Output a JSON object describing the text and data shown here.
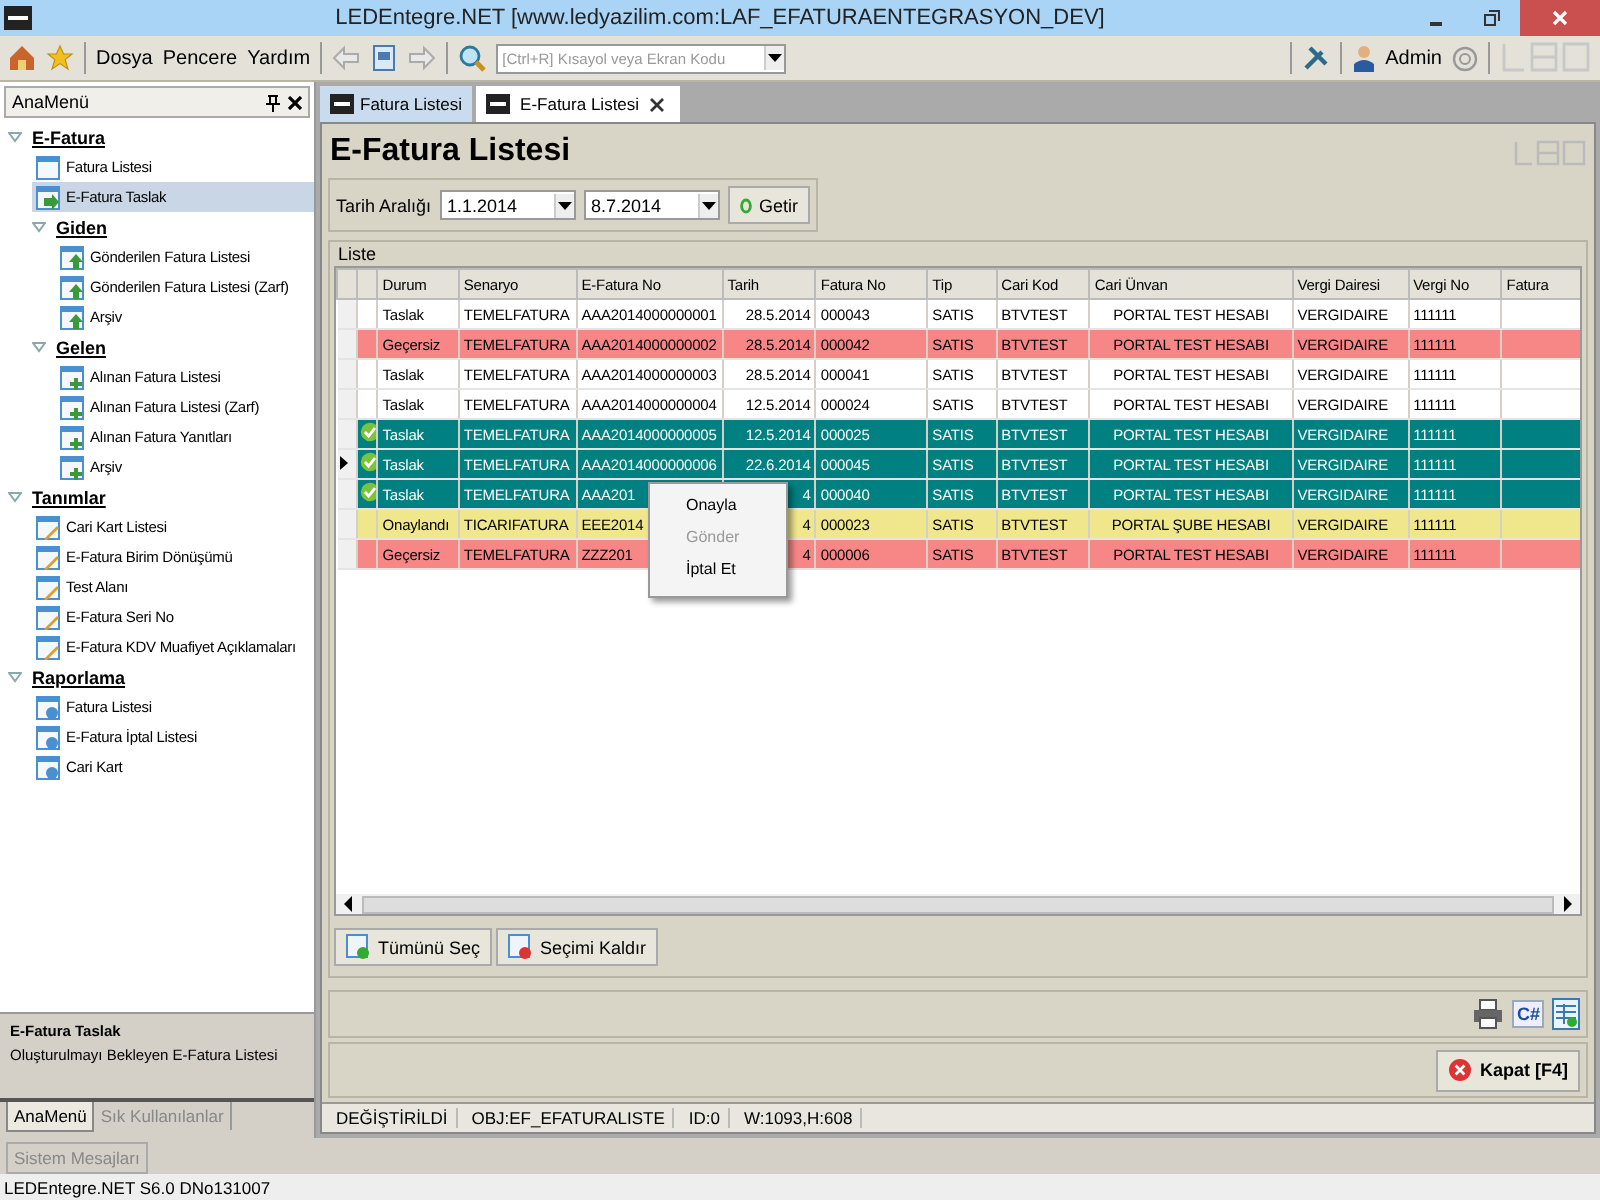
{
  "window": {
    "title": "LEDEntegre.NET [www.ledyazilim.com:LAF_EFATURAENTEGRASYON_DEV]"
  },
  "toolbar": {
    "menus": [
      "Dosya",
      "Pencere",
      "Yardım"
    ],
    "search": {
      "placeholder": "[Ctrl+R] Kısayol veya Ekran Kodu"
    },
    "user": "Admin"
  },
  "sidebar": {
    "title": "AnaMenü",
    "tree": [
      {
        "label": "E-Fatura",
        "kind": "group",
        "expanded": true,
        "selected": false,
        "children": [
          {
            "label": "Fatura Listesi",
            "kind": "list",
            "selected": false
          },
          {
            "label": "E-Fatura Taslak",
            "kind": "arrow",
            "selected": true
          },
          {
            "label": "Giden",
            "kind": "group",
            "expanded": true,
            "selected": false,
            "children": [
              {
                "label": "Gönderilen Fatura Listesi",
                "kind": "up",
                "selected": false
              },
              {
                "label": "Gönderilen Fatura Listesi (Zarf)",
                "kind": "up",
                "selected": false
              },
              {
                "label": "Arşiv",
                "kind": "up",
                "selected": false
              }
            ]
          },
          {
            "label": "Gelen",
            "kind": "group",
            "expanded": true,
            "selected": false,
            "children": [
              {
                "label": "Alınan Fatura Listesi",
                "kind": "plus",
                "selected": false
              },
              {
                "label": "Alınan Fatura Listesi (Zarf)",
                "kind": "plus",
                "selected": false
              },
              {
                "label": "Alınan Fatura Yanıtları",
                "kind": "plus",
                "selected": false
              },
              {
                "label": "Arşiv",
                "kind": "plus",
                "selected": false
              }
            ]
          }
        ]
      },
      {
        "label": "Tanımlar",
        "kind": "group",
        "expanded": true,
        "selected": false,
        "children": [
          {
            "label": "Cari Kart Listesi",
            "kind": "edit",
            "selected": false
          },
          {
            "label": "E-Fatura Birim Dönüşümü",
            "kind": "edit",
            "selected": false
          },
          {
            "label": "Test Alanı",
            "kind": "edit",
            "selected": false
          },
          {
            "label": "E-Fatura Seri No",
            "kind": "edit",
            "selected": false
          },
          {
            "label": "E-Fatura KDV Muafiyet Açıklamaları",
            "kind": "edit",
            "selected": false
          }
        ]
      },
      {
        "label": "Raporlama",
        "kind": "group",
        "expanded": true,
        "selected": false,
        "children": [
          {
            "label": "Fatura Listesi",
            "kind": "report",
            "selected": false
          },
          {
            "label": "E-Fatura İptal Listesi",
            "kind": "report",
            "selected": false
          },
          {
            "label": "Cari Kart",
            "kind": "report",
            "selected": false
          }
        ]
      }
    ],
    "description": {
      "title": "E-Fatura Taslak",
      "text": "Oluşturulmayı Bekleyen E-Fatura Listesi"
    },
    "tabs": [
      {
        "label": "AnaMenü",
        "selected": true
      },
      {
        "label": "Sık Kullanılanlar",
        "selected": false
      }
    ]
  },
  "doc_tabs": [
    {
      "label": "Fatura Listesi",
      "selected": false
    },
    {
      "label": "E-Fatura Listesi",
      "selected": true
    }
  ],
  "page": {
    "title": "E-Fatura Listesi",
    "filter": {
      "label": "Tarih Aralığı",
      "from": "1.1.2014",
      "to": "8.7.2014",
      "button": "Getir"
    }
  },
  "table": {
    "title": "Liste",
    "columns": [
      "Durum",
      "Senaryo",
      "E-Fatura No",
      "Tarih",
      "Fatura No",
      "Tip",
      "Cari Kod",
      "Cari Ünvan",
      "Vergi Dairesi",
      "Vergi No",
      "Fatura"
    ],
    "rows": [
      {
        "cells": [
          "Taslak",
          "TEMELFATURA",
          "AAA2014000000001",
          "28.5.2014",
          "000043",
          "SATIS",
          "BTVTEST",
          "PORTAL TEST HESABI",
          "VERGIDAIRE",
          "111111",
          ""
        ],
        "color": "#ffffff",
        "checked": false,
        "selected": false
      },
      {
        "cells": [
          "Geçersiz",
          "TEMELFATURA",
          "AAA2014000000002",
          "28.5.2014",
          "000042",
          "SATIS",
          "BTVTEST",
          "PORTAL TEST HESABI",
          "VERGIDAIRE",
          "111111",
          ""
        ],
        "color": "#f78787",
        "checked": false,
        "selected": false
      },
      {
        "cells": [
          "Taslak",
          "TEMELFATURA",
          "AAA2014000000003",
          "28.5.2014",
          "000041",
          "SATIS",
          "BTVTEST",
          "PORTAL TEST HESABI",
          "VERGIDAIRE",
          "111111",
          ""
        ],
        "color": "#ffffff",
        "checked": false,
        "selected": false
      },
      {
        "cells": [
          "Taslak",
          "TEMELFATURA",
          "AAA2014000000004",
          "12.5.2014",
          "000024",
          "SATIS",
          "BTVTEST",
          "PORTAL TEST HESABI",
          "VERGIDAIRE",
          "111111",
          ""
        ],
        "color": "#ffffff",
        "checked": false,
        "selected": false
      },
      {
        "cells": [
          "Taslak",
          "TEMELFATURA",
          "AAA2014000000005",
          "12.5.2014",
          "000025",
          "SATIS",
          "BTVTEST",
          "PORTAL TEST HESABI",
          "VERGIDAIRE",
          "111111",
          ""
        ],
        "color": "#008080",
        "checked": true,
        "selected": false
      },
      {
        "cells": [
          "Taslak",
          "TEMELFATURA",
          "AAA2014000000006",
          "22.6.2014",
          "000045",
          "SATIS",
          "BTVTEST",
          "PORTAL TEST HESABI",
          "VERGIDAIRE",
          "111111",
          ""
        ],
        "color": "#008080",
        "checked": true,
        "selected": true
      },
      {
        "cells": [
          "Taslak",
          "TEMELFATURA",
          "AAA201",
          "4",
          "000040",
          "SATIS",
          "BTVTEST",
          "PORTAL TEST HESABI",
          "VERGIDAIRE",
          "111111",
          ""
        ],
        "color": "#008080",
        "checked": true,
        "selected": false
      },
      {
        "cells": [
          "Onaylandı",
          "TICARIFATURA",
          "EEE2014",
          "4",
          "000023",
          "SATIS",
          "BTVTEST",
          "PORTAL ŞUBE HESABI",
          "VERGIDAIRE",
          "111111",
          ""
        ],
        "color": "#f0e68c",
        "checked": false,
        "selected": false
      },
      {
        "cells": [
          "Geçersiz",
          "TEMELFATURA",
          "ZZZ201",
          "4",
          "000006",
          "SATIS",
          "BTVTEST",
          "PORTAL TEST HESABI",
          "VERGIDAIRE",
          "111111",
          ""
        ],
        "color": "#f78787",
        "checked": false,
        "selected": false
      }
    ]
  },
  "context_menu": [
    {
      "label": "Onayla",
      "disabled": false
    },
    {
      "label": "Gönder",
      "disabled": true
    },
    {
      "label": "İptal Et",
      "disabled": false
    }
  ],
  "list_buttons": [
    "Tümünü Seç",
    "Seçimi Kaldır"
  ],
  "code_icon": "C#",
  "close_button": "Kapat [F4]",
  "form_status": [
    "DEĞİŞTİRİLDİ",
    "OBJ:EF_EFATURALISTE",
    "ID:0",
    "W:1093,H:608"
  ],
  "bottom_tab": "Sistem Mesajları",
  "status_bar": "LEDEntegre.NET S6.0 DNo131007"
}
